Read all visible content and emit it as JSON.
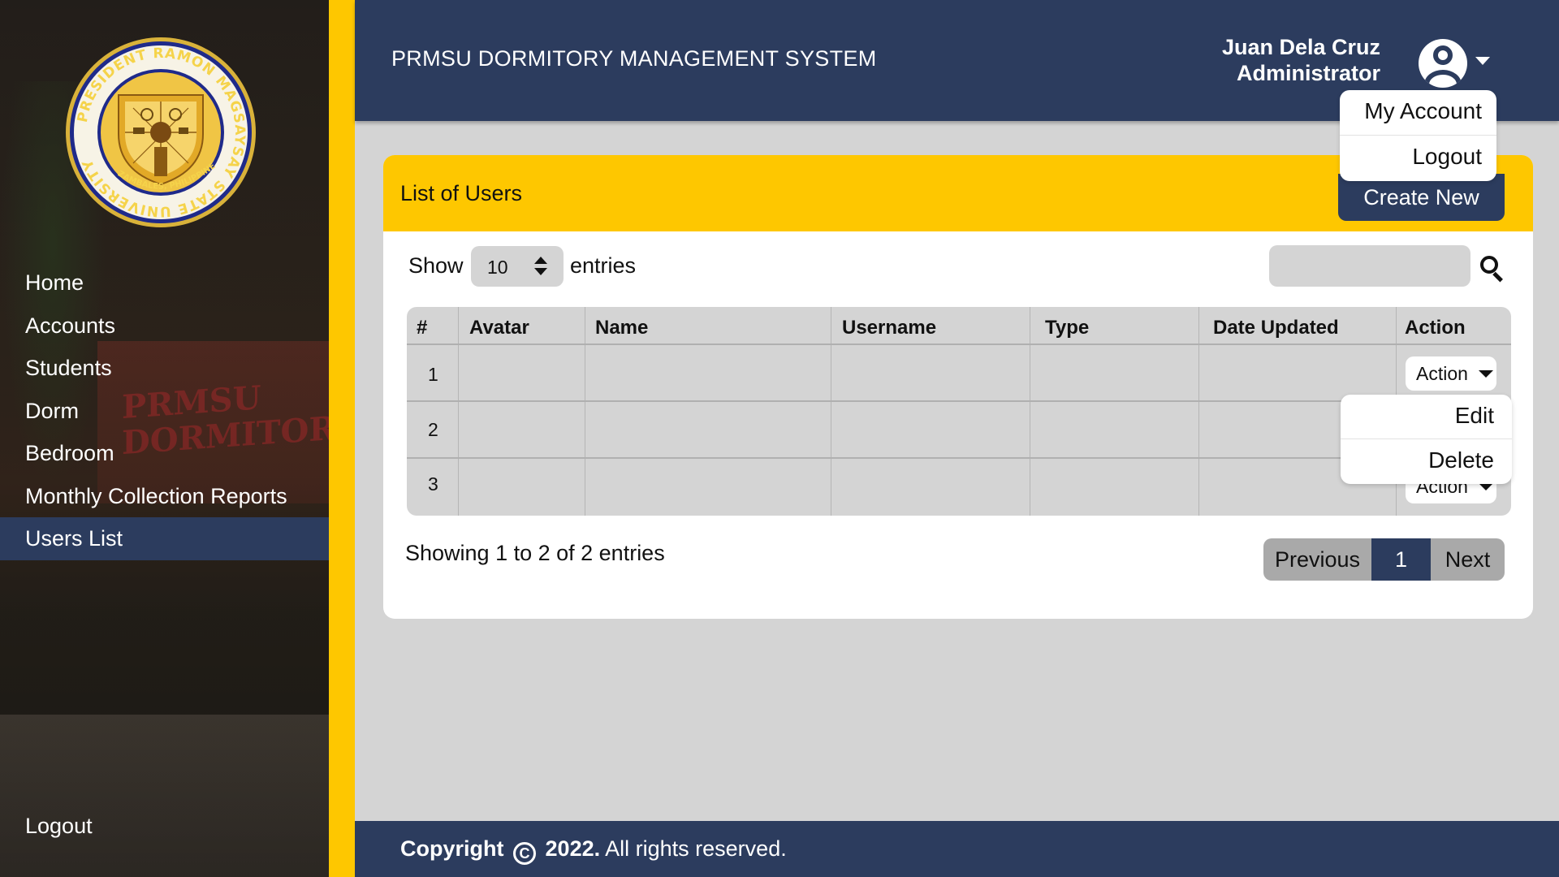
{
  "sidebar": {
    "logo": {
      "ring_text": "PRESIDENT RAMON MAGSAYSAY STATE UNIVERSITY",
      "bottom_text": "ZAMBALES, PHILIPPINES"
    },
    "background_sign": "PRMSU DORMITORY",
    "items": [
      {
        "label": "Home",
        "active": false
      },
      {
        "label": "Accounts",
        "active": false
      },
      {
        "label": "Students",
        "active": false
      },
      {
        "label": "Dorm",
        "active": false
      },
      {
        "label": "Bedroom",
        "active": false
      },
      {
        "label": "Monthly Collection Reports",
        "active": false
      },
      {
        "label": "Users List",
        "active": true
      }
    ],
    "logout_label": "Logout"
  },
  "header": {
    "title": "PRMSU DORMITORY MANAGEMENT SYSTEM",
    "user_name": "Juan Dela Cruz",
    "user_role": "Administrator",
    "avatar_icon": "user-circle-icon",
    "user_menu": [
      "My Account",
      "Logout"
    ]
  },
  "card": {
    "title": "List of Users",
    "create_label": "Create New",
    "show_label": "Show",
    "entries_value": "10",
    "entries_label": "entries",
    "search_placeholder": "",
    "table": {
      "columns": [
        "#",
        "Avatar",
        "Name",
        "Username",
        "Type",
        "Date Updated",
        "Action"
      ],
      "rows": [
        {
          "num": "1",
          "action_label": "Action"
        },
        {
          "num": "2",
          "action_label": "Action"
        },
        {
          "num": "3",
          "action_label": "Action"
        }
      ]
    },
    "action_menu": [
      "Edit",
      "Delete"
    ],
    "showing_text": "Showing 1 to 2 of 2 entries",
    "pagination": {
      "prev": "Previous",
      "current": "1",
      "next": "Next"
    }
  },
  "footer": {
    "copyright_word": "Copyright",
    "year": "2022.",
    "rights": "All rights reserved."
  },
  "colors": {
    "navy": "#2c3c5e",
    "yellow": "#fec700",
    "content_bg": "#d4d4d4"
  }
}
